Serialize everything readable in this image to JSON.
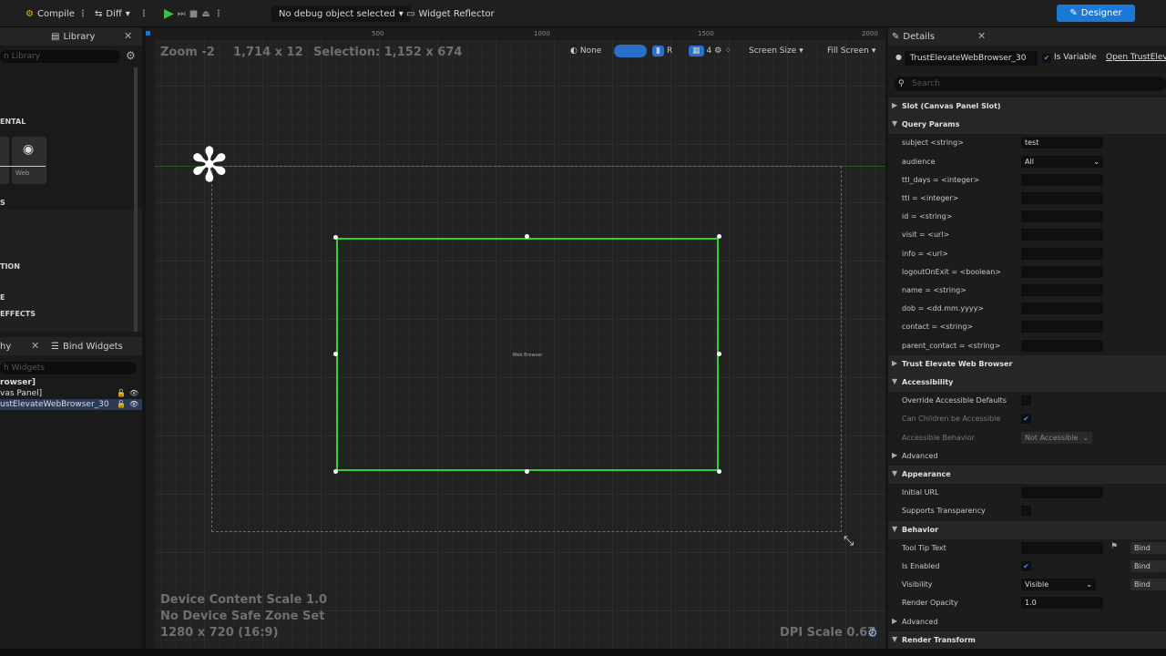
{
  "toolbar": {
    "compile_label": "Compile",
    "diff_label": "Diff",
    "debug_object": "No debug object selected",
    "widget_reflector": "Widget Reflector",
    "designer_label": "Designer"
  },
  "left": {
    "library_tab": "Library",
    "library_search": "n Library",
    "sections": [
      "ENTAL",
      "S",
      "TION",
      "E",
      "EFFECTS"
    ],
    "palette_card_label": "Web",
    "hierarchy_tab": "hy",
    "bind_widgets_tab": "Bind Widgets",
    "hierarchy_search": "h Widgets",
    "tree": [
      "rowser]",
      "vas Panel]",
      "ustElevateWebBrowser_30"
    ]
  },
  "viewport": {
    "ruler_marks": [
      "500",
      "1000",
      "1500",
      "2000"
    ],
    "zoom": "Zoom -2",
    "size": "1,714 x 12",
    "selection": "Selection: 1,152 x 674",
    "none_label": "None",
    "r_label": "R",
    "grid_count": "4",
    "screen_size": "Screen Size",
    "fill_screen": "Fill Screen",
    "web_browser_label": "Web Browser",
    "device_content_scale": "Device Content Scale 1.0",
    "safe_zone": "No Device Safe Zone Set",
    "resolution": "1280 x 720 (16:9)",
    "dpi_scale": "DPI Scale 0.67"
  },
  "details": {
    "tab": "Details",
    "widget_name": "TrustElevateWebBrowser_30",
    "is_variable": "Is Variable",
    "open_link": "Open TrustEleva",
    "search_placeholder": "Search",
    "rows": [
      {
        "type": "cat",
        "label": "Slot (Canvas Panel Slot)",
        "arrow": "▶"
      },
      {
        "type": "cat",
        "label": "Query Params",
        "arrow": "▼"
      },
      {
        "type": "field",
        "label": "subject <string>",
        "value": "test"
      },
      {
        "type": "dropdown",
        "label": "audience",
        "value": "All"
      },
      {
        "type": "field",
        "label": "ttl_days = <integer>",
        "value": ""
      },
      {
        "type": "field",
        "label": "ttl = <integer>",
        "value": ""
      },
      {
        "type": "field",
        "label": "id = <string>",
        "value": ""
      },
      {
        "type": "field",
        "label": "visit = <url>",
        "value": ""
      },
      {
        "type": "field",
        "label": "info = <url>",
        "value": ""
      },
      {
        "type": "field",
        "label": "logoutOnExit = <boolean>",
        "value": ""
      },
      {
        "type": "field",
        "label": "name = <string>",
        "value": ""
      },
      {
        "type": "field",
        "label": "dob = <dd.mm.yyyy>",
        "value": ""
      },
      {
        "type": "field",
        "label": "contact = <string>",
        "value": ""
      },
      {
        "type": "field",
        "label": "parent_contact = <string>",
        "value": ""
      },
      {
        "type": "cat",
        "label": "Trust Elevate Web Browser",
        "arrow": "▶"
      },
      {
        "type": "cat",
        "label": "Accessibility",
        "arrow": "▼"
      },
      {
        "type": "check",
        "label": "Override Accessible Defaults",
        "value": ""
      },
      {
        "type": "check-dim",
        "label": "Can Children be Accessible",
        "value": "✔"
      },
      {
        "type": "dropdown-dim",
        "label": "Accessible Behavior",
        "value": "Not Accessible"
      },
      {
        "type": "plain",
        "label": "Advanced",
        "arrow": "▶"
      },
      {
        "type": "cat",
        "label": "Appearance",
        "arrow": "▼"
      },
      {
        "type": "field",
        "label": "Initial URL",
        "value": ""
      },
      {
        "type": "check",
        "label": "Supports Transparency",
        "value": ""
      },
      {
        "type": "cat",
        "label": "Behavior",
        "arrow": "▼"
      },
      {
        "type": "field-bind",
        "label": "Tool Tip Text",
        "value": "",
        "bind": "Bind"
      },
      {
        "type": "check-bind",
        "label": "Is Enabled",
        "value": "✔",
        "bind": "Bind"
      },
      {
        "type": "dropdown-bind",
        "label": "Visibility",
        "value": "Visible",
        "bind": "Bind"
      },
      {
        "type": "field",
        "label": "Render Opacity",
        "value": "1.0"
      },
      {
        "type": "plain",
        "label": "Advanced",
        "arrow": "▶"
      },
      {
        "type": "cat",
        "label": "Render Transform",
        "arrow": "▼"
      }
    ]
  }
}
